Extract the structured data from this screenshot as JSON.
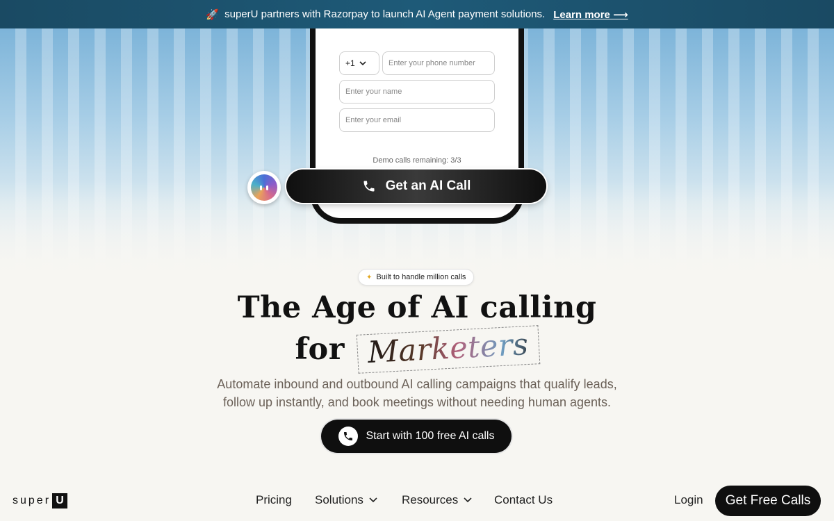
{
  "announcement": {
    "text": "superU partners with Razorpay to launch AI Agent payment solutions.",
    "link": "Learn more ⟶"
  },
  "phone_form": {
    "country_code": "+1",
    "phone_placeholder": "Enter your phone number",
    "name_placeholder": "Enter your name",
    "email_placeholder": "Enter your email",
    "demo_remaining": "Demo calls remaining: 3/3"
  },
  "ai_call_button": "Get an AI Call",
  "badge": "Built to handle million calls",
  "headline": {
    "line1": "The Age of AI calling",
    "line2_prefix": "for",
    "highlight": "Marketers"
  },
  "subtitle": {
    "line1": "Automate inbound and outbound AI calling campaigns that qualify leads,",
    "line2": "follow up instantly, and book meetings without needing human agents."
  },
  "cta": "Start with 100 free AI calls",
  "nav": {
    "logo": "super",
    "logo_mark": "U",
    "items": [
      "Pricing",
      "Solutions",
      "Resources",
      "Contact Us"
    ],
    "login": "Login",
    "get_free": "Get Free Calls"
  },
  "icons": {
    "announce": "rocket-icon",
    "call": "phone-icon",
    "dropdown": "chevron-down-icon",
    "badge": "sparkle-icon"
  }
}
